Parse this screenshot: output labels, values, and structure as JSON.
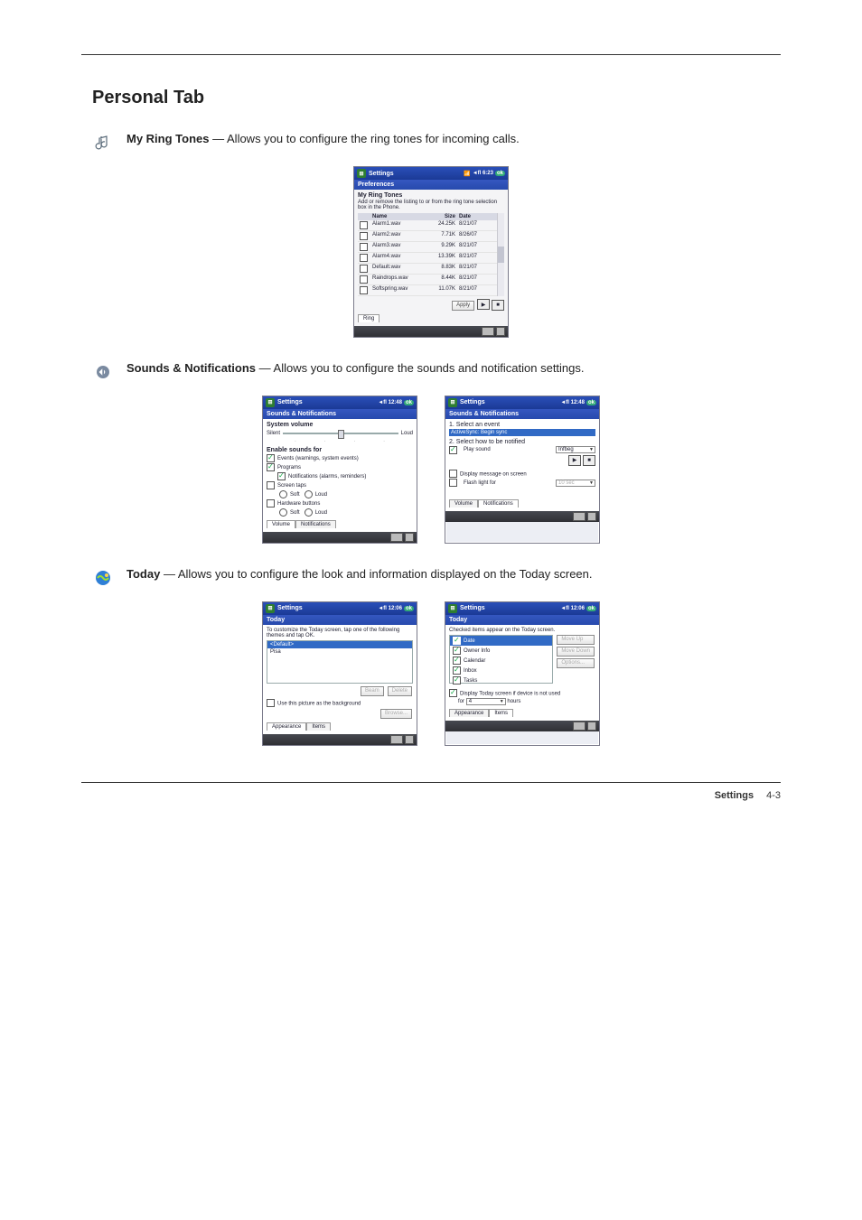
{
  "heading": "Personal Tab",
  "sections": {
    "ringtones": {
      "icon_label": "♪",
      "title": "My Ring Tones",
      "desc": "— Allows you to configure the ring tones for incoming calls.",
      "screen": {
        "title": "Settings",
        "status": "◄ﬂ 6:23",
        "panel": "Preferences",
        "subtitle": "My Ring Tones",
        "hint": "Add or remove the listing to or from the ring tone selection box in the Phone.",
        "columns": [
          "",
          "Name",
          "Size",
          "Date"
        ],
        "rows": [
          {
            "name": "Alarm1.wav",
            "size": "24.25K",
            "date": "8/21/07"
          },
          {
            "name": "Alarm2.wav",
            "size": "7.71K",
            "date": "8/26/07"
          },
          {
            "name": "Alarm3.wav",
            "size": "9.29K",
            "date": "8/21/07"
          },
          {
            "name": "Alarm4.wav",
            "size": "13.39K",
            "date": "8/21/07"
          },
          {
            "name": "Default.wav",
            "size": "8.83K",
            "date": "8/21/07"
          },
          {
            "name": "Raindrops.wav",
            "size": "8.44K",
            "date": "8/21/07"
          },
          {
            "name": "Softspring.wav",
            "size": "11.07K",
            "date": "8/21/07"
          }
        ],
        "apply_btn": "Apply",
        "tab": "Ring"
      }
    },
    "sounds": {
      "title": "Sounds & Notifications",
      "desc": "— Allows you to configure the sounds and notification settings.",
      "left": {
        "title": "Settings",
        "status": "◄ﬂ 12:48",
        "panel": "Sounds & Notifications",
        "vol_label": "System volume",
        "silent": "Silent",
        "loud": "Loud",
        "enable_label": "Enable sounds for",
        "opts": [
          {
            "on": true,
            "label": "Events (warnings, system events)"
          },
          {
            "on": true,
            "label": "Programs"
          },
          {
            "on": true,
            "indent": true,
            "label": "Notifications (alarms, reminders)"
          },
          {
            "on": false,
            "label": "Screen taps"
          },
          {
            "radios": [
              "Soft",
              "Loud"
            ]
          },
          {
            "on": false,
            "label": "Hardware buttons"
          },
          {
            "radios": [
              "Soft",
              "Loud"
            ]
          }
        ],
        "tabs": [
          "Volume",
          "Notifications"
        ]
      },
      "right": {
        "title": "Settings",
        "status": "◄ﬂ 12:48",
        "panel": "Sounds & Notifications",
        "step1": "1. Select an event",
        "event_sel": "ActiveSync: Begin sync",
        "step2": "2. Select how to be notified",
        "play_sound": "Play sound",
        "sound_sel": "Infbeg",
        "disp_msg": "Display message on screen",
        "flash": "Flash light for",
        "flash_sel": "10 sec",
        "tabs": [
          "Volume",
          "Notifications"
        ]
      }
    },
    "today": {
      "title": "Today",
      "desc": "— Allows you to configure the look and information displayed on the Today screen.",
      "left": {
        "title": "Settings",
        "status": "◄ﬂ 12:06",
        "panel": "Today",
        "hint": "To customize the Today screen, tap one of the following themes and tap OK.",
        "themes": [
          "<Default>",
          "Pisa"
        ],
        "beam": "Beam",
        "delete": "Delete",
        "use_pic": "Use this picture as the background",
        "browse": "Browse...",
        "tabs": [
          "Appearance",
          "Items"
        ]
      },
      "right": {
        "title": "Settings",
        "status": "◄ﬂ 12:06",
        "panel": "Today",
        "hint": "Checked items appear on the Today screen.",
        "items": [
          {
            "on": true,
            "label": "Date",
            "sel": true
          },
          {
            "on": true,
            "label": "Owner Info"
          },
          {
            "on": true,
            "label": "Calendar"
          },
          {
            "on": true,
            "label": "Inbox"
          },
          {
            "on": true,
            "label": "Tasks"
          }
        ],
        "moveup": "Move Up",
        "movedown": "Move Down",
        "options": "Options...",
        "disp_today": "Display Today screen if device is not used",
        "for_lbl": "for",
        "hours_val": "4",
        "hours_lbl": "hours",
        "tabs": [
          "Appearance",
          "Items"
        ]
      }
    }
  },
  "footer": {
    "text": "Settings",
    "page": "4-3"
  }
}
